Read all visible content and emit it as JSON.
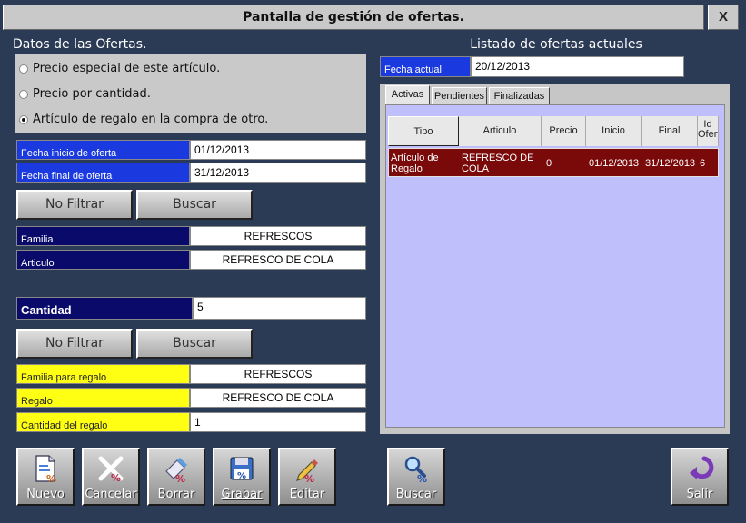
{
  "window": {
    "title": "Pantalla de gestión de ofertas.",
    "close_label": "X"
  },
  "left": {
    "title": "Datos de las Ofertas.",
    "radios": [
      {
        "label": "Precio especial de este artículo.",
        "checked": false
      },
      {
        "label": "Precio por cantidad.",
        "checked": false
      },
      {
        "label": "Artículo de regalo en la compra de otro.",
        "checked": true
      }
    ],
    "fecha_inicio": {
      "label": "Fecha inicio de oferta",
      "value": "01/12/2013"
    },
    "fecha_final": {
      "label": "Fecha final de oferta",
      "value": "31/12/2013"
    },
    "filter1": {
      "no_filtrar": "No Filtrar",
      "buscar": "Buscar"
    },
    "familia": {
      "label": "Familia",
      "value": "REFRESCOS"
    },
    "articulo": {
      "label": "Articulo",
      "value": "REFRESCO DE COLA"
    },
    "cantidad": {
      "label": "Cantidad",
      "value": "5"
    },
    "filter2": {
      "no_filtrar": "No Filtrar",
      "buscar": "Buscar"
    },
    "familia_regalo": {
      "label": "Familia para regalo",
      "value": "REFRESCOS"
    },
    "regalo": {
      "label": "Regalo",
      "value": "REFRESCO DE COLA"
    },
    "cantidad_regalo": {
      "label": "Cantidad del regalo",
      "value": "1"
    }
  },
  "right": {
    "title": "Listado de ofertas actuales",
    "fecha_actual": {
      "label": "Fecha actual",
      "value": "20/12/2013"
    },
    "tabs": [
      "Activas",
      "Pendientes",
      "Finalizadas"
    ],
    "columns": [
      "Tipo",
      "Articulo",
      "Precio",
      "Inicio",
      "Final",
      "Id\nOferta"
    ],
    "rows": [
      [
        "Artículo de\nRegalo",
        "REFRESCO DE\nCOLA",
        "0",
        "01/12/2013",
        "31/12/2013",
        "6"
      ]
    ]
  },
  "toolbar": {
    "nuevo": "Nuevo",
    "cancelar": "Cancelar",
    "borrar": "Borrar",
    "grabar": "Grabar",
    "editar": "Editar",
    "buscar": "Buscar",
    "salir": "Salir"
  },
  "icons": {
    "nuevo": "new-document-icon",
    "cancelar": "cancel-x-icon",
    "borrar": "eraser-icon",
    "grabar": "floppy-disk-icon",
    "editar": "pencil-icon",
    "buscar": "magnifier-icon",
    "salir": "exit-arrow-icon"
  },
  "colors": {
    "background": "#2b3a55",
    "label_blue": "#1a3ae0",
    "label_navy": "#0a0a6a",
    "label_yellow": "#ffff14",
    "row_selected": "#7a0a0a",
    "grid_bg": "#bfbffb"
  }
}
